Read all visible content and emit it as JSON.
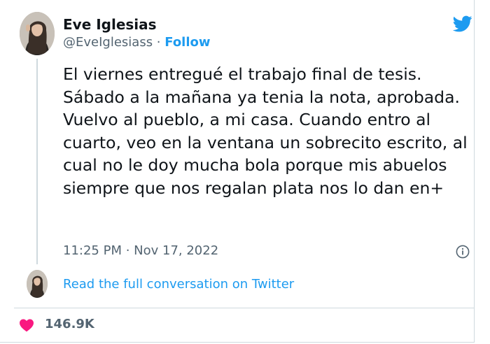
{
  "author": {
    "display_name": "Eve Iglesias",
    "handle": "@EveIglesiass",
    "separator": " · ",
    "follow_label": "Follow",
    "avatar_icon": "profile-photo"
  },
  "brand": {
    "icon": "twitter-bird-icon",
    "color": "#1d9bf0"
  },
  "tweet": {
    "text": "El viernes entregué el trabajo final de tesis.\nSábado a la mañana ya tenia la nota, aprobada.\nVuelvo al pueblo, a mi casa. Cuando entro al cuarto, veo en la ventana un sobrecito escrito, al cual no le doy mucha bola porque mis abuelos siempre que nos regalan plata nos lo dan en+",
    "timestamp": "11:25 PM · Nov 17, 2022",
    "info_icon": "info-icon"
  },
  "conversation": {
    "link_label": "Read the full conversation on Twitter"
  },
  "engagement": {
    "like_icon": "heart-icon",
    "like_color": "#f91880",
    "like_count": "146.9K"
  }
}
